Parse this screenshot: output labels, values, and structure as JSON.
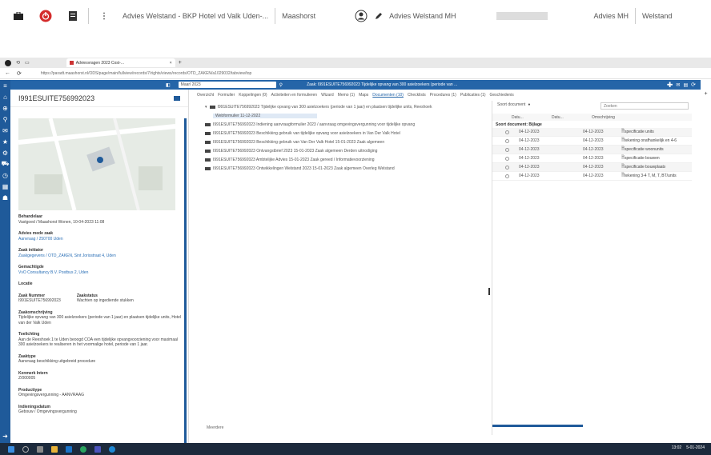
{
  "topbar": {
    "items": [
      {
        "text": "Advies Welstand - BKP Hotel vd Valk Uden-..."
      },
      {
        "text": "Maashorst"
      },
      {
        "text": "Advies Welstand MH"
      },
      {
        "text": "Advies MH"
      },
      {
        "text": "Welstand"
      }
    ]
  },
  "browser": {
    "tab_label": "Adviesvragen 2023 Cost-...",
    "url": "https://paradt.maashorst.nl/ODS/page/main/fullview/records/7/rights/views/records/OTD_ZAKEN/a1029032/tabview/top"
  },
  "app": {
    "search_value": "Maarl 2023",
    "head_title": "Zaak: I991ESUITE756992023 Tijdelijke opvang van 300 asielzoekers (periode van ...",
    "case_title": "I991ESUITE756992023",
    "tabs": [
      "Overzicht",
      "Formulier",
      "Koppelingen (0)",
      "Activiteiten en formulieren",
      "Wizard",
      "Memo (1)",
      "Maps",
      "Documenten (10)",
      "Checklists",
      "Procedures (1)",
      "Publicaties (1)",
      "Geschiedenis"
    ],
    "active_tab_index": 7,
    "left_fields": [
      {
        "label": "Behandelaar",
        "value": "Vastgoed / Maashorst Wonen, 10-04-2023 11:08",
        "link": false
      },
      {
        "label": "Advies mede zaak",
        "value": "Aanvraag / 250700 Uden",
        "link": true
      },
      {
        "label": "Zaak initiator",
        "value": "Zaakgegevens / OTD_ZAKEN, Sint Jorisstraat 4, Uden",
        "link": true
      },
      {
        "label": "Gemachtigde",
        "value": "VvO Consultancy B.V. Postbus 2, Uden",
        "link": true
      },
      {
        "label": "Locatie",
        "value": "",
        "link": false
      },
      {
        "label": "Zaak Nummer",
        "value": "I991ESUITE756992023",
        "link": false
      },
      {
        "label": "Zaakstatus",
        "value": "Wachten op ingediende stukken",
        "link": false
      },
      {
        "label": "Zaakomschrijving",
        "value": "Tijdelijke opvang van 300 asielzoekers (periode van 1 jaar) en plaatsen tijdelijke units, Hotel van der Valk Uden",
        "link": false
      },
      {
        "label": "Toelichting",
        "value": "Aan de Reeshoek 1 te Uden beoogd COA een tijdelijke opvangvoorziening voor maximaal 300 asielzoekers te realiseren in het voormalige hotel, periode van 1 jaar.",
        "link": false
      },
      {
        "label": "Zaaktype",
        "value": "Aanvraag beschikking uitgebreid procedure",
        "link": false
      },
      {
        "label": "Kenmerk Intern",
        "value": "Z/000005",
        "link": false
      },
      {
        "label": "Producttype",
        "value": "Omgevingsvergunning - AANVRAAG",
        "link": false
      },
      {
        "label": "Indieningsdatum",
        "value": "Gebouw / Omgevingsvergunning",
        "link": false
      }
    ],
    "tree": [
      {
        "text": "I991ESUITE756992023 Tijdelijke opvang van 300 asielzoekers (periode van 1 jaar) en plaatsen tijdelijke units, Reeshoek",
        "sel": false
      },
      {
        "text": "Webformulier 11-12-2022",
        "sel": true
      },
      {
        "text": "I991ESUITE756992023 Indiening aanvraagformulier 2023 / aanvraag omgevingsvergunning voor tijdelijke opvang",
        "sel": false
      },
      {
        "text": "I991ESUITE756992023 Beschikking gebruik van tijdelijke opvang voor asielzoekers in Van Der Valk Hotel",
        "sel": false
      },
      {
        "text": "I991ESUITE756992023 Beschikking gebruik van Van Der Valk Hotel 15-01-2023 Zaak algemeen",
        "sel": false
      },
      {
        "text": "I991ESUITE756992023 Ontvangstbrief 2023 15-01-2023 Zaak algemeen Derden uitnodiging",
        "sel": false
      },
      {
        "text": "I991ESUITE756992023 Ambtelijke Advies 15-01-2023 Zaak gereed / Informatievoorziening",
        "sel": false
      },
      {
        "text": "I991ESUITE756992023 Ontwikkelingen Welstand 2023 15-01-2023 Zaak algemeen Overleg Welstand",
        "sel": false
      }
    ],
    "right_panel": {
      "toolbar_label": "Soort document",
      "search_placeholder": "Zoeken",
      "columns": [
        "Datu...",
        "Datu...",
        "Omschrijving"
      ],
      "group_label": "Soort document: Bijlage",
      "rows": [
        {
          "d1": "04-12-2023",
          "d2": "04-12-2023",
          "desc": "specificatie units"
        },
        {
          "d1": "04-12-2023",
          "d2": "04-12-2023",
          "desc": "tekening onafhankelijk en 4-6"
        },
        {
          "d1": "04-12-2023",
          "d2": "04-12-2023",
          "desc": "specificatie woonunits"
        },
        {
          "d1": "04-12-2023",
          "d2": "04-12-2023",
          "desc": "specificatie bouwen"
        },
        {
          "d1": "04-12-2023",
          "d2": "04-12-2023",
          "desc": "specificatie bouwplaats"
        },
        {
          "d1": "04-12-2023",
          "d2": "04-12-2023",
          "desc": "tekening 3-4 T, M, T, BT/units"
        }
      ]
    },
    "bottom_text": "Meerdere"
  },
  "taskbar": {
    "time": "13:02",
    "date": "5-01-2024"
  },
  "colors": {
    "accent": "#2565a8",
    "rail": "#1f5a9a",
    "taskbar": "#1c2a3c"
  }
}
